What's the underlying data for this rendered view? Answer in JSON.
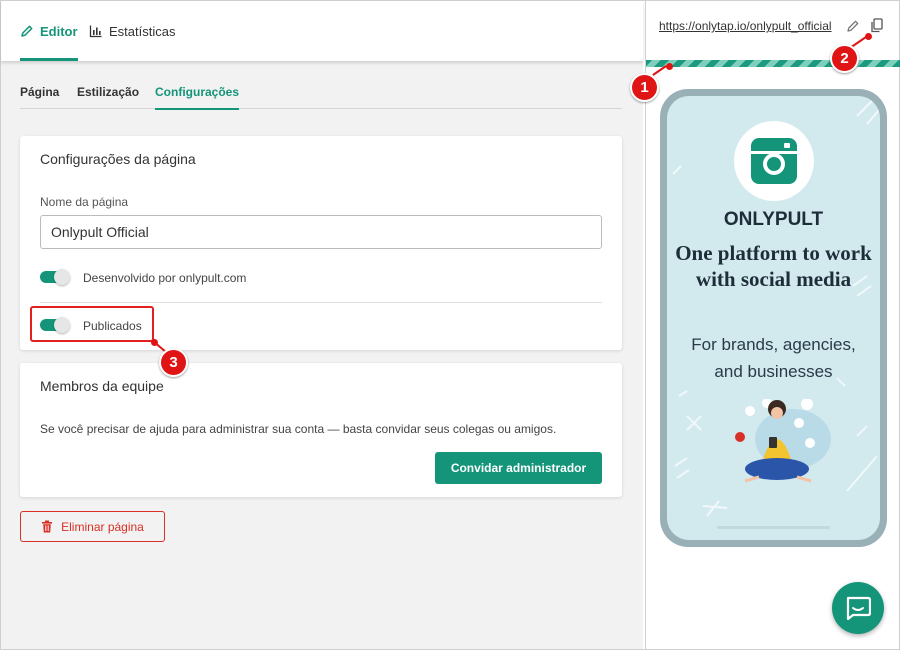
{
  "top_tabs": {
    "editor": "Editor",
    "statistics": "Estatísticas"
  },
  "sub_tabs": {
    "page": "Página",
    "styling": "Estilização",
    "settings": "Configurações"
  },
  "page_settings": {
    "title": "Configurações da página",
    "name_label": "Nome da página",
    "name_value": "Onlypult Official",
    "powered_by_label": "Desenvolvido por onlypult.com",
    "powered_by_on": true,
    "published_label": "Publicados",
    "published_on": true
  },
  "team": {
    "title": "Membros da equipe",
    "description": "Se você precisar de ajuda para administrar sua conta — basta convidar seus colegas ou amigos.",
    "invite_button": "Convidar administrador"
  },
  "delete_button": "Eliminar página",
  "preview": {
    "url": "https://onlytap.io/onlypult_official",
    "brand": "ONLYPULT",
    "headline": "One platform to work with social media",
    "subheadline": "For brands, agencies, and businesses"
  },
  "markers": [
    "1",
    "2",
    "3"
  ],
  "colors": {
    "accent": "#14957a",
    "danger": "#d93025",
    "marker": "#e01414",
    "phone_bg": "#d2e9ee"
  }
}
